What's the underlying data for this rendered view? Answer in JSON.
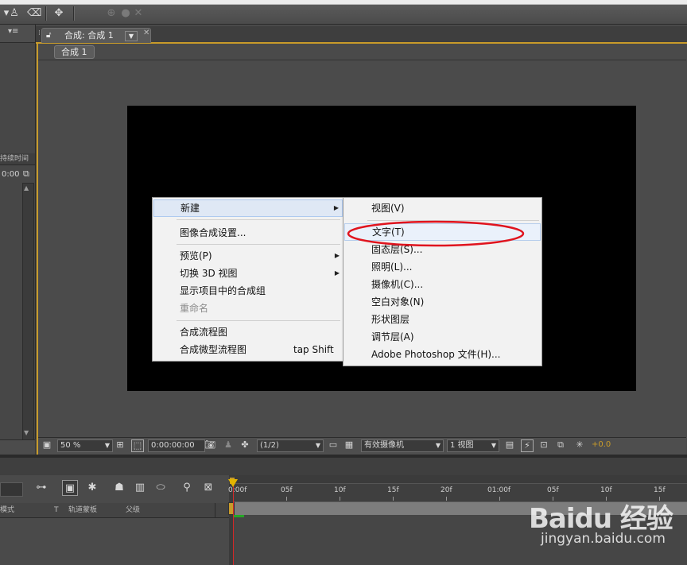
{
  "comp_tab": {
    "label": "合成: 合成 1"
  },
  "breadcrumb": {
    "label": "合成 1"
  },
  "left_panel": {
    "header": "持续时间",
    "timecode": "0:00"
  },
  "context_menu": {
    "items": [
      {
        "label": "新建",
        "has_submenu": true,
        "highlighted": true
      },
      {
        "label": "图像合成设置..."
      },
      {
        "label": "预览(P)",
        "has_submenu": true
      },
      {
        "label": "切换 3D 视图",
        "has_submenu": true
      },
      {
        "label": "显示项目中的合成组"
      },
      {
        "label": "重命名",
        "disabled": true
      },
      {
        "label": "合成流程图"
      },
      {
        "label": "合成微型流程图",
        "shortcut": "tap Shift"
      }
    ]
  },
  "submenu": {
    "items": [
      {
        "label": "视图(V)"
      },
      {
        "label": "文字(T)",
        "highlighted": true,
        "circled": true
      },
      {
        "label": "固态层(S)..."
      },
      {
        "label": "照明(L)..."
      },
      {
        "label": "摄像机(C)..."
      },
      {
        "label": "空白对象(N)"
      },
      {
        "label": "形状图层"
      },
      {
        "label": "调节层(A)"
      },
      {
        "label": "Adobe Photoshop 文件(H)..."
      }
    ]
  },
  "comp_footer": {
    "zoom": "50 %",
    "timecode": "0:00:00:00",
    "resolution": "(1/2)",
    "camera": "有效摄像机",
    "views": "1 视图",
    "exposure": "+0.0"
  },
  "timeline": {
    "columns": {
      "mode": "模式",
      "t": "T",
      "track_matte": "轨道蒙板",
      "parent": "父级"
    },
    "ruler_ticks": [
      "0:00f",
      "05f",
      "10f",
      "15f",
      "20f",
      "01:00f",
      "05f",
      "10f",
      "15f"
    ]
  },
  "watermark": {
    "brand": "Baidu 经验",
    "url": "jingyan.baidu.com"
  },
  "colors": {
    "highlight_ellipse": "#e0141e",
    "panel_accent": "#c89b2a",
    "playhead": "#d42828"
  }
}
